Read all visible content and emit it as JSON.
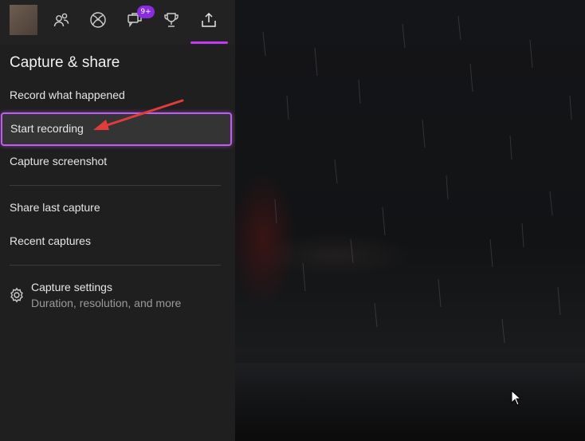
{
  "toolbar": {
    "items": [
      {
        "icon": "avatar"
      },
      {
        "icon": "people-icon"
      },
      {
        "icon": "xbox-icon"
      },
      {
        "icon": "chat-icon",
        "badge": "9+"
      },
      {
        "icon": "trophy-icon"
      },
      {
        "icon": "share-upload-icon",
        "active": true
      }
    ]
  },
  "panel": {
    "title": "Capture & share",
    "items": [
      {
        "label": "Record what happened"
      },
      {
        "label": "Start recording",
        "highlighted": true
      },
      {
        "label": "Capture screenshot"
      },
      {
        "label": "Share last capture"
      },
      {
        "label": "Recent captures"
      }
    ],
    "settings": {
      "title": "Capture settings",
      "subtitle": "Duration, resolution, and more"
    }
  },
  "colors": {
    "accent": "#c05cf0",
    "badge": "#8a2be2",
    "panel_bg": "#1f1f1f",
    "annotation_arrow": "#e23b3b"
  }
}
